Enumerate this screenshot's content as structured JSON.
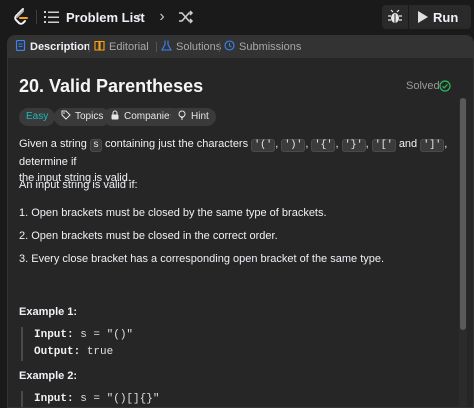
{
  "topbar": {
    "list_title": "Problem List",
    "prev_glyph": "‹",
    "next_glyph": "›",
    "run_label": "Run"
  },
  "tabs": [
    {
      "label": "Description",
      "icon": "document-icon"
    },
    {
      "label": "Editorial",
      "icon": "book-icon"
    },
    {
      "label": "Solutions",
      "icon": "flask-icon"
    },
    {
      "label": "Submissions",
      "icon": "history-icon"
    }
  ],
  "problem": {
    "title": "20. Valid Parentheses",
    "status": "Solved",
    "chips": [
      "Easy",
      "Topics",
      "Companies",
      "Hint"
    ],
    "desc_1": "Given a string",
    "desc_var": "s",
    "desc_2": "containing just the characters",
    "chars": [
      "'('",
      "')'",
      "'{'",
      "'}'",
      "'['",
      "']'"
    ],
    "desc_and": "and",
    "desc_3": ", determine if",
    "desc_4": "the input string is valid.",
    "valid_intro": "An input string is valid if:",
    "rules": [
      "1. Open brackets must be closed by the same type of brackets.",
      "2. Open brackets must be closed in the correct order.",
      "3. Every close bracket has a corresponding open bracket of the same type."
    ]
  },
  "examples": [
    {
      "title": "Example 1:",
      "input_label": "Input:",
      "input": "s = \"()\"",
      "output_label": "Output:",
      "output": "true"
    },
    {
      "title": "Example 2:",
      "input_label": "Input:",
      "input": "s = \"()[]{}\""
    }
  ],
  "colors": {
    "easy": "#1cbaba",
    "solved": "#2cbb5d",
    "accent": "#ffa116"
  }
}
